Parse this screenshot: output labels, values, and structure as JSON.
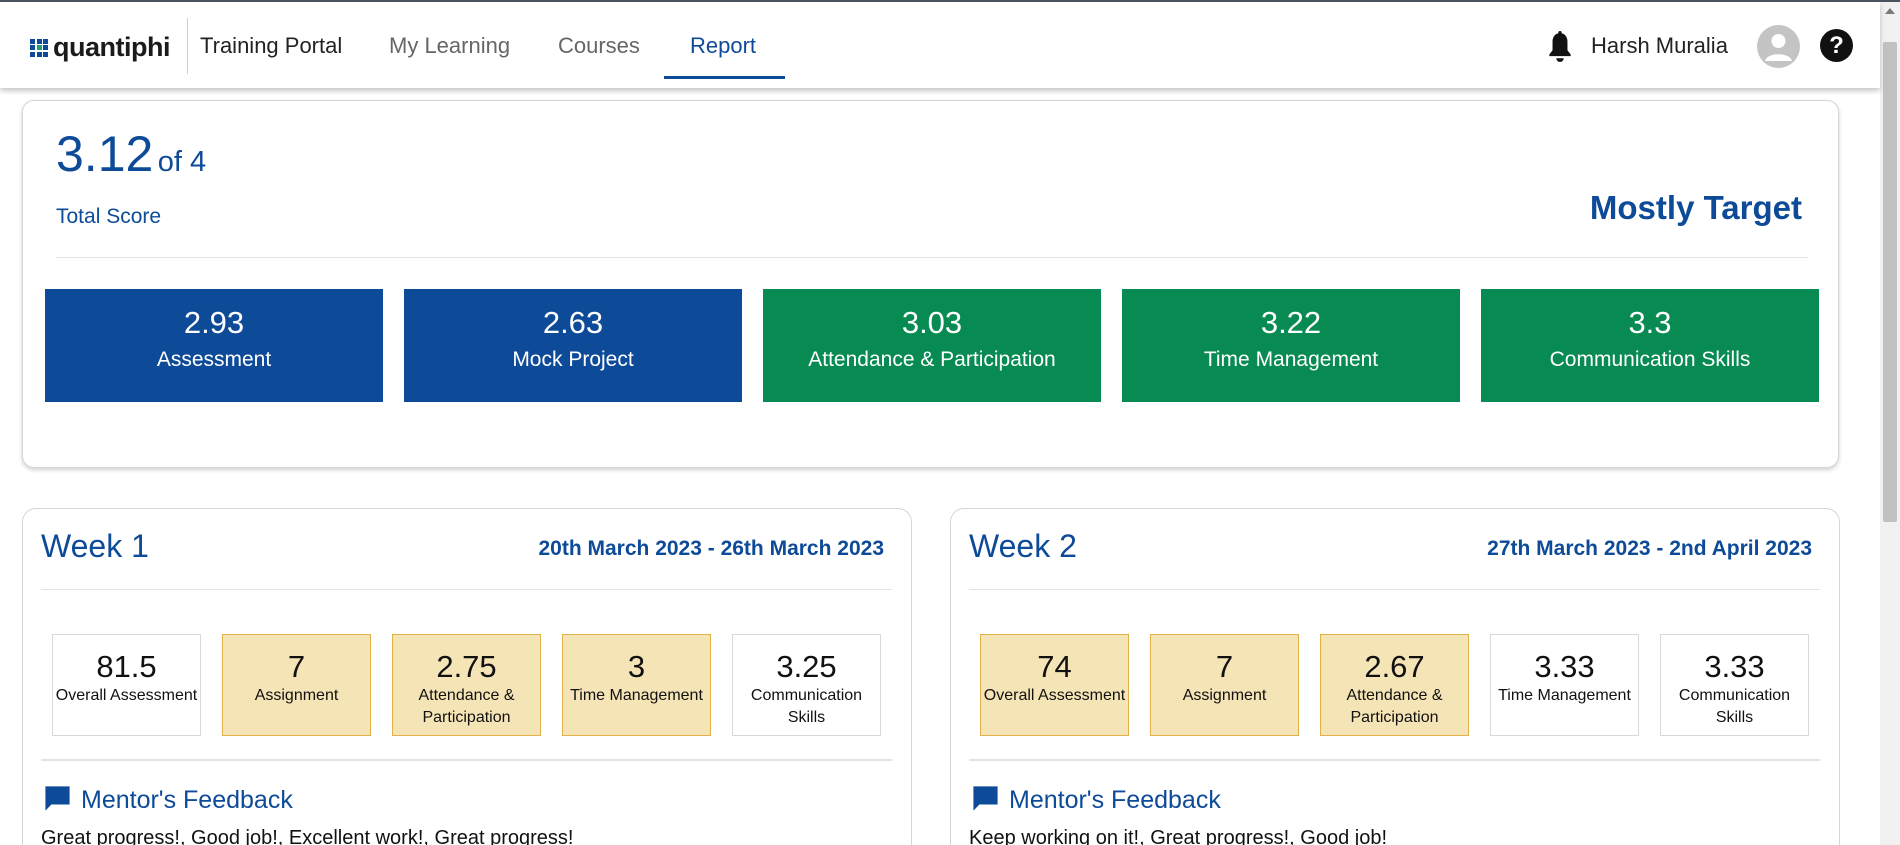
{
  "header": {
    "brand": "quantiphi",
    "portal_title": "Training Portal",
    "nav": [
      {
        "label": "My Learning",
        "active": false
      },
      {
        "label": "Courses",
        "active": false
      },
      {
        "label": "Report",
        "active": true
      }
    ],
    "user_name": "Harsh Muralia",
    "help_label": "?",
    "icons": [
      "bell-icon",
      "avatar-icon",
      "help-icon"
    ]
  },
  "summary": {
    "score": "3.12",
    "score_of": "of 4",
    "score_label": "Total Score",
    "rating": "Mostly Target",
    "tiles": [
      {
        "value": "2.93",
        "label": "Assessment",
        "color": "#0d4a98"
      },
      {
        "value": "2.63",
        "label": "Mock Project",
        "color": "#0d4a98"
      },
      {
        "value": "3.03",
        "label": "Attendance & Participation",
        "color": "#088b53"
      },
      {
        "value": "3.22",
        "label": "Time Management",
        "color": "#088b53"
      },
      {
        "value": "3.3",
        "label": "Communication Skills",
        "color": "#088b53"
      }
    ]
  },
  "weeks": [
    {
      "title": "Week 1",
      "range": "20th March 2023 - 26th March 2023",
      "metrics": [
        {
          "value": "81.5",
          "label": "Overall Assessment",
          "highlight": false
        },
        {
          "value": "7",
          "label": "Assignment",
          "highlight": true
        },
        {
          "value": "2.75",
          "label": "Attendance & Participation",
          "highlight": true
        },
        {
          "value": "3",
          "label": "Time Management",
          "highlight": true
        },
        {
          "value": "3.25",
          "label": "Communication Skills",
          "highlight": false
        }
      ],
      "feedback_title": "Mentor's Feedback",
      "feedback_text": "Great progress!, Good job!, Excellent work!, Great progress!"
    },
    {
      "title": "Week 2",
      "range": "27th March 2023 - 2nd April 2023",
      "metrics": [
        {
          "value": "74",
          "label": "Overall Assessment",
          "highlight": true
        },
        {
          "value": "7",
          "label": "Assignment",
          "highlight": true
        },
        {
          "value": "2.67",
          "label": "Attendance & Participation",
          "highlight": true
        },
        {
          "value": "3.33",
          "label": "Time Management",
          "highlight": false
        },
        {
          "value": "3.33",
          "label": "Communication Skills",
          "highlight": false
        }
      ],
      "feedback_title": "Mentor's Feedback",
      "feedback_text": "Keep working on it!, Great progress!, Good job!"
    }
  ],
  "colors": {
    "accent": "#0d4a98",
    "green": "#088b53",
    "highlight_bg": "#f5e4b5",
    "highlight_border": "#e2b24a"
  }
}
